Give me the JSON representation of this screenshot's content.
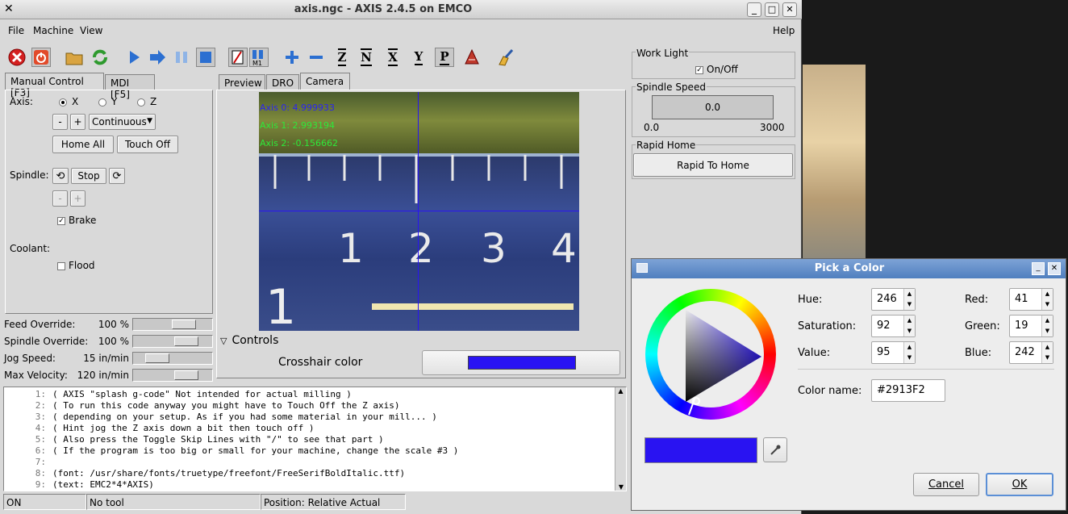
{
  "window": {
    "title": "axis.ngc - AXIS 2.4.5 on EMCO"
  },
  "menu": {
    "file": "File",
    "machine": "Machine",
    "view": "View",
    "help": "Help"
  },
  "toolbar": {
    "axis_z": "Z",
    "axis_x": "X",
    "axis_y": "Y",
    "axis_p": "P"
  },
  "left_tabs": {
    "manual": "Manual Control [F3]",
    "mdi": "MDI [F5]"
  },
  "manual": {
    "axis_label": "Axis:",
    "axis_x": "X",
    "axis_y": "Y",
    "axis_z": "Z",
    "minus": "-",
    "plus": "+",
    "jog_mode": "Continuous",
    "home_all": "Home All",
    "touch_off": "Touch Off",
    "spindle_label": "Spindle:",
    "stop": "Stop",
    "brake": "Brake",
    "coolant_label": "Coolant:",
    "flood": "Flood"
  },
  "overrides": [
    {
      "label": "Feed Override:",
      "value": "100 %",
      "fraction": 0.7
    },
    {
      "label": "Spindle Override:",
      "value": "100 %",
      "fraction": 0.75
    },
    {
      "label": "Jog Speed:",
      "value": "15 in/min",
      "fraction": 0.22
    },
    {
      "label": "Max Velocity:",
      "value": "120 in/min",
      "fraction": 0.75
    }
  ],
  "view_tabs": {
    "preview": "Preview",
    "dro": "DRO",
    "camera": "Camera"
  },
  "camera": {
    "overlay": [
      "Axis 0: 4.999933",
      "Axis 1: 2.993194",
      "Axis 2: -0.156662"
    ],
    "ruler_numbers": [
      "1",
      "2",
      "3",
      "4"
    ],
    "controls_label": "Controls",
    "crosshair_label": "Crosshair color",
    "crosshair_color": "#2913F2"
  },
  "gcode": [
    {
      "n": "1:",
      "text": "( AXIS \"splash g-code\" Not intended for actual milling )"
    },
    {
      "n": "2:",
      "text": "( To run this code anyway you might have to Touch Off the Z axis)"
    },
    {
      "n": "3:",
      "text": "( depending on your setup. As if you had some material in your mill... )"
    },
    {
      "n": "4:",
      "text": "( Hint jog the Z axis down a bit then touch off )"
    },
    {
      "n": "5:",
      "text": "( Also press the Toggle Skip Lines with \"/\" to see that part )"
    },
    {
      "n": "6:",
      "text": "( If the program is too big or small for your machine, change the scale #3 )"
    },
    {
      "n": "7:",
      "text": ""
    },
    {
      "n": "8:",
      "text": "(font: /usr/share/fonts/truetype/freefont/FreeSerifBoldItalic.ttf)"
    },
    {
      "n": "9:",
      "text": "(text: EMC2*4*AXIS)"
    }
  ],
  "status": {
    "state": "ON",
    "tool": "No tool",
    "position": "Position: Relative Actual"
  },
  "right_panel": {
    "work_light": "Work Light",
    "on_off": "On/Off",
    "spindle_speed": "Spindle Speed",
    "speed_value": "0.0",
    "scale_min": "0.0",
    "scale_max": "3000",
    "rapid_home": "Rapid Home",
    "rapid_to_home": "Rapid To Home"
  },
  "color_dialog": {
    "title": "Pick a Color",
    "hue_label": "Hue:",
    "hue": "246",
    "sat_label": "Saturation:",
    "sat": "92",
    "val_label": "Value:",
    "val": "95",
    "red_label": "Red:",
    "red": "41",
    "green_label": "Green:",
    "green": "19",
    "blue_label": "Blue:",
    "blue": "242",
    "name_label": "Color name:",
    "name": "#2913F2",
    "cancel": "Cancel",
    "ok": "OK",
    "color": "#2913F2"
  }
}
